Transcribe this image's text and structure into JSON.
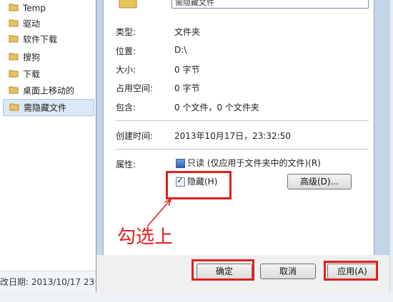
{
  "explorer": {
    "folders": [
      {
        "label": "Temp",
        "selected": false
      },
      {
        "label": "驱动",
        "selected": false
      },
      {
        "label": "软件下载",
        "selected": false
      },
      {
        "label": "搜狗",
        "selected": false
      },
      {
        "label": "下载",
        "selected": false
      },
      {
        "label": "桌面上移动的",
        "selected": false
      },
      {
        "label": "需隐藏文件",
        "selected": true
      }
    ],
    "status_date": "改日期: 2013/10/17 23"
  },
  "properties": {
    "name_value": "需隐藏文件",
    "rows": [
      {
        "label": "类型:",
        "value": "文件夹"
      },
      {
        "label": "位置:",
        "value": "D:\\"
      },
      {
        "label": "大小:",
        "value": "0 字节"
      },
      {
        "label": "占用空间:",
        "value": "0 字节"
      },
      {
        "label": "包含:",
        "value": "0 个文件，0 个文件夹"
      }
    ],
    "created_label": "创建时间:",
    "created_value": "2013年10月17日，23:32:50",
    "attributes_label": "属性:",
    "readonly_label": "只读 (仅应用于文件夹中的文件)(R)",
    "hidden_label": "隐藏(H)",
    "hidden_checked": true,
    "advanced_button": "高级(D)..."
  },
  "footer": {
    "ok_button": "确定",
    "cancel_button": "取消",
    "apply_button": "应用(A)"
  },
  "annotation": {
    "text": "勾选上",
    "color": "#e01f1f"
  }
}
